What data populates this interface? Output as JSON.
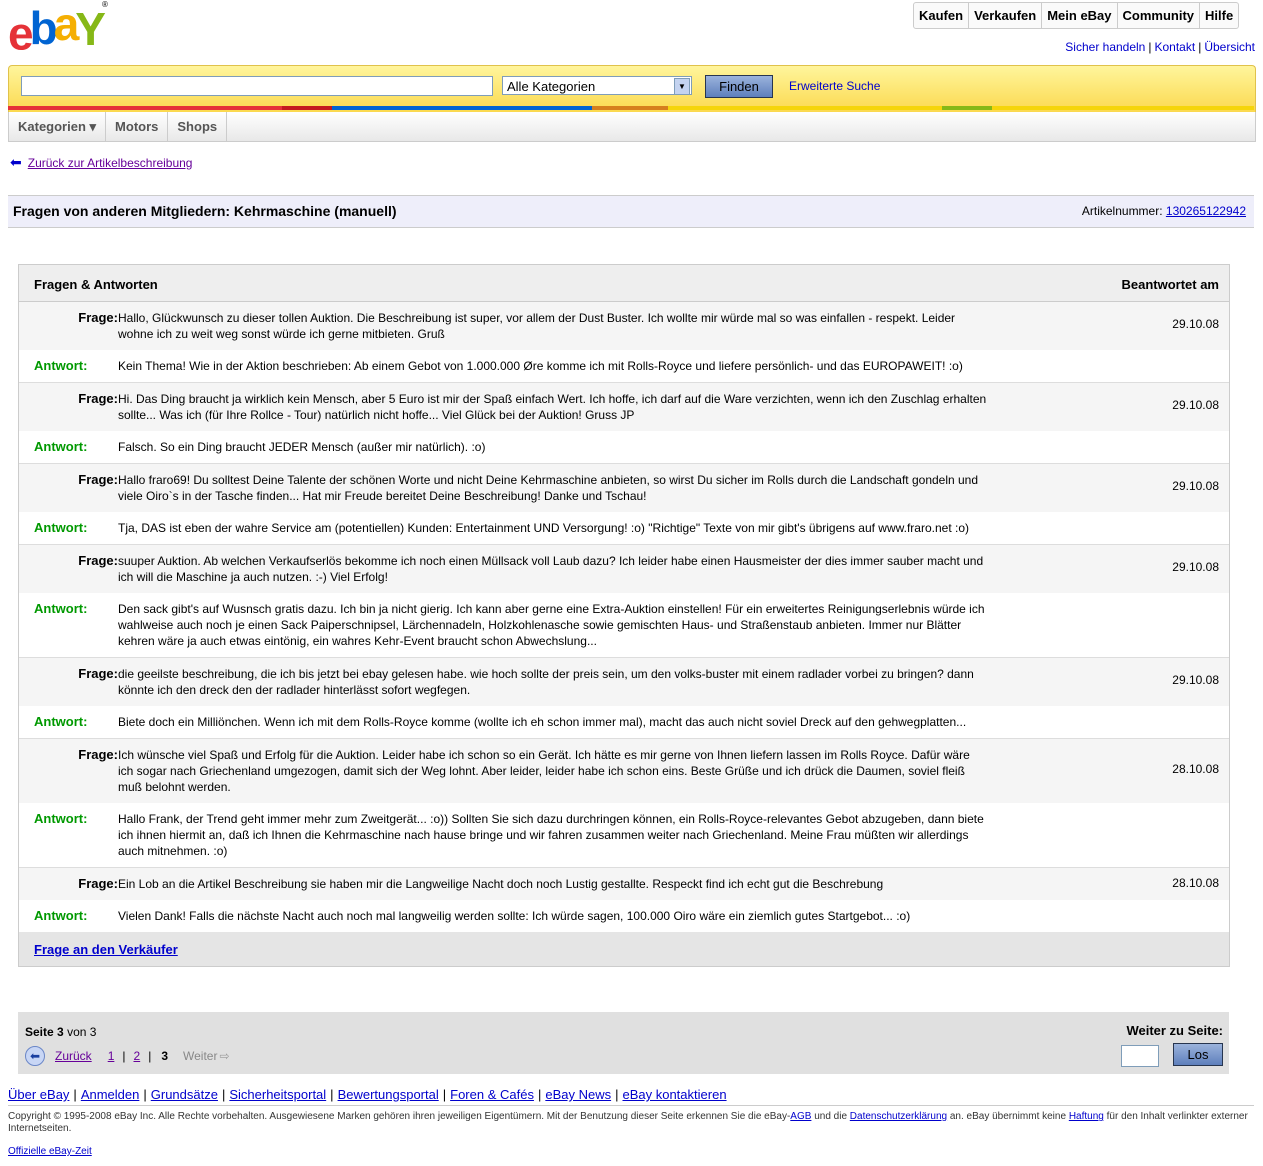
{
  "header": {
    "logo_text": "ebay",
    "top_nav": [
      "Kaufen",
      "Verkaufen",
      "Mein eBay",
      "Community",
      "Hilfe"
    ],
    "top_links": [
      "Sicher handeln",
      "Kontakt",
      "Übersicht"
    ]
  },
  "search": {
    "input_value": "",
    "category_selected": "Alle Kategorien",
    "find_label": "Finden",
    "advanced_label": "Erweiterte Suche"
  },
  "secondary_nav": [
    "Kategorien ▾",
    "Motors",
    "Shops"
  ],
  "colors": {
    "strip": [
      "#e53238",
      "#e53238",
      "#0064d2",
      "#d67f1d",
      "#f5d50b",
      "#86b817",
      "#f5d50b"
    ]
  },
  "back_link": "Zurück zur Artikelbeschreibung",
  "title_bar": {
    "title": "Fragen von anderen Mitgliedern: Kehrmaschine (manuell)",
    "item_number_label": "Artikelnummer:",
    "item_number": "130265122942"
  },
  "qa": {
    "header_left": "Fragen & Antworten",
    "header_right": "Beantwortet am",
    "question_label": "Frage:",
    "answer_label": "Antwort:",
    "items": [
      {
        "q": "Hallo, Glückwunsch zu dieser tollen Auktion. Die Beschreibung ist super, vor allem der Dust Buster. Ich wollte mir würde mal so was einfallen - respekt. Leider wohne ich zu weit weg sonst würde ich gerne mitbieten. Gruß",
        "a": "Kein Thema! Wie in der Aktion beschrieben: Ab einem Gebot von 1.000.000 Øre komme ich mit Rolls-Royce und liefere persönlich- und das EUROPAWEIT! :o)",
        "date": "29.10.08"
      },
      {
        "q": "Hi. Das Ding braucht ja wirklich kein Mensch, aber 5 Euro ist mir der Spaß einfach Wert. Ich hoffe, ich darf auf die Ware verzichten, wenn ich den Zuschlag erhalten sollte... Was ich (für Ihre Rollce - Tour) natürlich nicht hoffe... Viel Glück bei der Auktion! Gruss JP",
        "a": "Falsch. So ein Ding braucht JEDER Mensch (außer mir natürlich). :o)",
        "date": "29.10.08"
      },
      {
        "q": "Hallo fraro69! Du solltest Deine Talente der schönen Worte und nicht Deine Kehrmaschine anbieten, so wirst Du sicher im Rolls durch die Landschaft gondeln und viele Oiro`s in der Tasche finden... Hat mir Freude bereitet Deine Beschreibung! Danke und Tschau!",
        "a": "Tja, DAS ist eben der wahre Service am (potentiellen) Kunden: Entertainment UND Versorgung! :o) \"Richtige\" Texte von mir gibt's übrigens auf www.fraro.net :o)",
        "date": "29.10.08"
      },
      {
        "q": "suuper Auktion. Ab welchen Verkaufserlös bekomme ich noch einen Müllsack voll Laub dazu? Ich leider habe einen Hausmeister der dies immer sauber macht und ich will die Maschine ja auch nutzen. :-) Viel Erfolg!",
        "a": "Den sack gibt's auf Wusnsch gratis dazu. Ich bin ja nicht gierig. Ich kann aber gerne eine Extra-Auktion einstellen! Für ein erweitertes Reinigungserlebnis würde ich wahlweise auch noch je einen Sack Paiperschnipsel, Lärchennadeln, Holzkohlenasche sowie gemischten Haus- und Straßenstaub anbieten. Immer nur Blätter kehren wäre ja auch etwas eintönig, ein wahres Kehr-Event braucht schon Abwechslung...",
        "date": "29.10.08"
      },
      {
        "q": "die geeilste beschreibung, die ich bis jetzt bei ebay gelesen habe. wie hoch sollte der preis sein, um den volks-buster mit einem radlader vorbei zu bringen? dann könnte ich den dreck den der radlader hinterlässt sofort wegfegen.",
        "a": "Biete doch ein Milliönchen. Wenn ich mit dem Rolls-Royce komme (wollte ich eh schon immer mal), macht das auch nicht soviel Dreck auf den gehwegplatten...",
        "date": "29.10.08"
      },
      {
        "q": "Ich wünsche viel Spaß und Erfolg für die Auktion. Leider habe ich schon so ein Gerät. Ich hätte es mir gerne von Ihnen liefern lassen im Rolls Royce. Dafür wäre ich sogar nach Griechenland umgezogen, damit sich der Weg lohnt. Aber leider, leider habe ich schon eins. Beste Grüße und ich drück die Daumen, soviel fleiß muß belohnt werden.",
        "a": "Hallo Frank, der Trend geht immer mehr zum Zweitgerät... :o)) Sollten Sie sich dazu durchringen können, ein Rolls-Royce-relevantes Gebot abzugeben, dann biete ich ihnen hiermit an, daß ich Ihnen die Kehrmaschine nach hause bringe und wir fahren zusammen weiter nach Griechenland. Meine Frau müßten wir allerdings auch mitnehmen. :o)",
        "date": "28.10.08"
      },
      {
        "q": "Ein Lob an die Artikel Beschreibung sie haben mir die Langweilige Nacht doch noch Lustig gestallte. Respeckt find ich echt gut die Beschrebung",
        "a": "Vielen Dank! Falls die nächste Nacht auch noch mal langweilig werden sollte: Ich würde sagen, 100.000 Oiro wäre ein ziemlich gutes Startgebot... :o)",
        "date": "28.10.08"
      }
    ],
    "footer_link": "Frage an den Verkäufer"
  },
  "pager": {
    "page_word": "Seite",
    "current": "3",
    "of_word": "von",
    "total": "3",
    "back": "Zurück",
    "pages": [
      "1",
      "2",
      "3"
    ],
    "next": "Weiter",
    "goto_label": "Weiter zu Seite:",
    "goto_value": "",
    "goto_button": "Los"
  },
  "footer": {
    "links": [
      "Über eBay",
      "Anmelden",
      "Grundsätze",
      "Sicherheitsportal",
      "Bewertungsportal",
      "Foren & Cafés",
      "eBay News",
      "eBay kontaktieren"
    ],
    "copyright_1": "Copyright © 1995-2008 eBay Inc. Alle Rechte vorbehalten. Ausgewiesene Marken gehören ihren jeweiligen Eigentümern. Mit der Benutzung dieser Seite erkennen Sie die eBay-",
    "agb": "AGB",
    "copyright_2": " und die ",
    "privacy": "Datenschutzerklärung",
    "copyright_3": " an. eBay übernimmt keine ",
    "liability": "Haftung",
    "copyright_4": " für den Inhalt verlinkter externer Internetseiten.",
    "ebay_time": "Offizielle eBay-Zeit"
  }
}
